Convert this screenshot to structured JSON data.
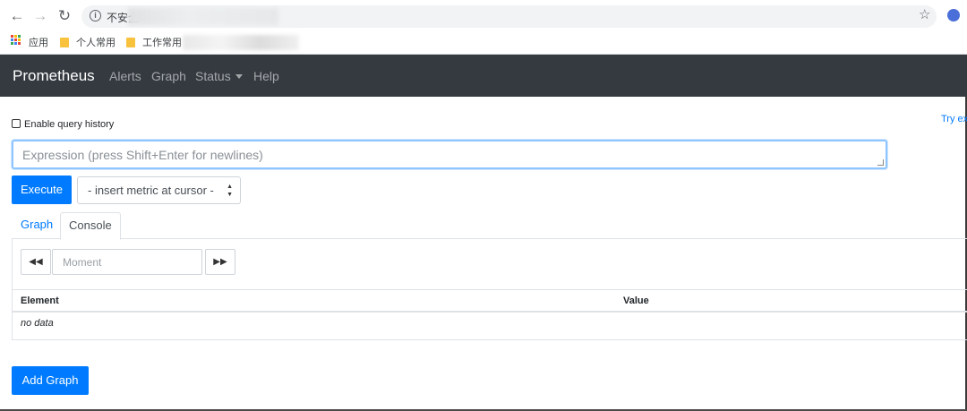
{
  "browser": {
    "url_prefix": "不安全",
    "bookmarks": [
      {
        "label": "应用"
      },
      {
        "label": "个人常用"
      },
      {
        "label": "工作常用"
      }
    ]
  },
  "navbar": {
    "brand": "Prometheus",
    "links": [
      "Alerts",
      "Graph",
      "Status",
      "Help"
    ]
  },
  "query": {
    "history_label": "Enable query history",
    "history_checked": false,
    "try_link": "Try ex",
    "expression_placeholder": "Expression (press Shift+Enter for newlines)",
    "execute_label": "Execute",
    "metric_select": "- insert metric at cursor -"
  },
  "tabs": [
    {
      "label": "Graph",
      "active": false
    },
    {
      "label": "Console",
      "active": true
    }
  ],
  "console": {
    "moment_placeholder": "Moment",
    "columns": [
      "Element",
      "Value"
    ],
    "empty_text": "no data"
  },
  "add_graph_label": "Add Graph",
  "colors": {
    "navbar_bg": "#343a40",
    "primary": "#007bff"
  }
}
